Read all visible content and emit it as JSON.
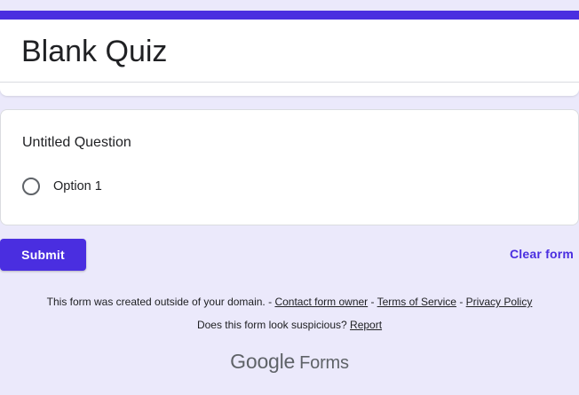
{
  "form": {
    "title": "Blank Quiz",
    "accent_color": "#4a2ee0"
  },
  "question": {
    "title": "Untitled Question",
    "options": [
      {
        "label": "Option 1",
        "selected": false
      }
    ]
  },
  "actions": {
    "submit_label": "Submit",
    "clear_label": "Clear form"
  },
  "footer": {
    "created_text": "This form was created outside of your domain.",
    "sep1": " - ",
    "contact_link": "Contact form owner",
    "sep2": " - ",
    "terms_link": "Terms of Service",
    "sep3": " - ",
    "privacy_link": "Privacy Policy",
    "suspicious_text": "Does this form look suspicious?",
    "report_link": "Report"
  },
  "brand": {
    "google": "Google",
    "forms": "Forms"
  }
}
